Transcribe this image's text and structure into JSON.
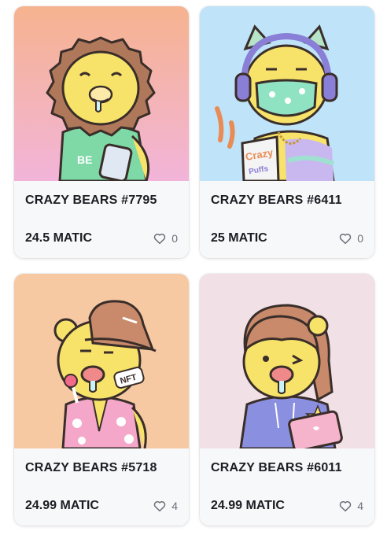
{
  "cards": [
    {
      "title": "CRAZY BEARS #7795",
      "price": "24.5 MATIC",
      "likes": "0",
      "shirt_text": "BE",
      "bg_top": "#f6b38f",
      "bg_bottom": "#f2b4d9"
    },
    {
      "title": "CRAZY BEARS #6411",
      "price": "25 MATIC",
      "likes": "0",
      "bag_text": "Crazy",
      "bag_text2": "Puffs",
      "bg_top": "#bfe3f8",
      "bg_bottom": "#bfe3f8"
    },
    {
      "title": "CRAZY BEARS #5718",
      "price": "24.99 MATIC",
      "likes": "4",
      "patch_text": "NFT",
      "bg_top": "#f6c9a3",
      "bg_bottom": "#f6c9a3"
    },
    {
      "title": "CRAZY BEARS #6011",
      "price": "24.99 MATIC",
      "likes": "4",
      "bg_top": "#f1e0e6",
      "bg_bottom": "#f1e0e6"
    }
  ],
  "icons": {
    "like": "heart-outline-icon"
  }
}
